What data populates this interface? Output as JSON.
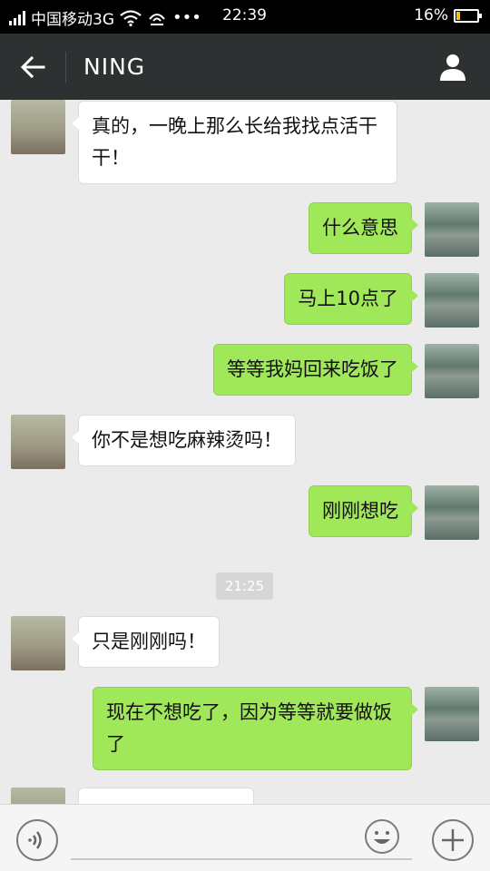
{
  "status_bar": {
    "carrier": "中国移动3G",
    "time": "22:39",
    "battery": "16%",
    "battery_level": 0.16
  },
  "header": {
    "title": "NING",
    "back_icon": "arrow-left-icon",
    "profile_icon": "person-icon"
  },
  "messages": [
    {
      "side": "left",
      "text": "真的，一晚上那么长给我找点活干干！"
    },
    {
      "side": "right",
      "text": "什么意思"
    },
    {
      "side": "right",
      "text": "马上10点了"
    },
    {
      "side": "right",
      "text": "等等我妈回来吃饭了"
    },
    {
      "side": "left",
      "text": "你不是想吃麻辣烫吗！"
    },
    {
      "side": "right",
      "text": "刚刚想吃"
    },
    {
      "side": "left",
      "text": "只是刚刚吗！"
    },
    {
      "side": "right",
      "text": "现在不想吃了，因为等等就要做饭了"
    }
  ],
  "timestamp": "21:25",
  "input_bar": {
    "voice_icon": "voice-icon",
    "emoji_icon": "smiley-icon",
    "plus_icon": "plus-icon"
  },
  "colors": {
    "header_bg": "#2e3132",
    "outgoing_bubble": "#a0e75a",
    "incoming_bubble": "#ffffff",
    "chat_bg": "#ebebeb"
  }
}
